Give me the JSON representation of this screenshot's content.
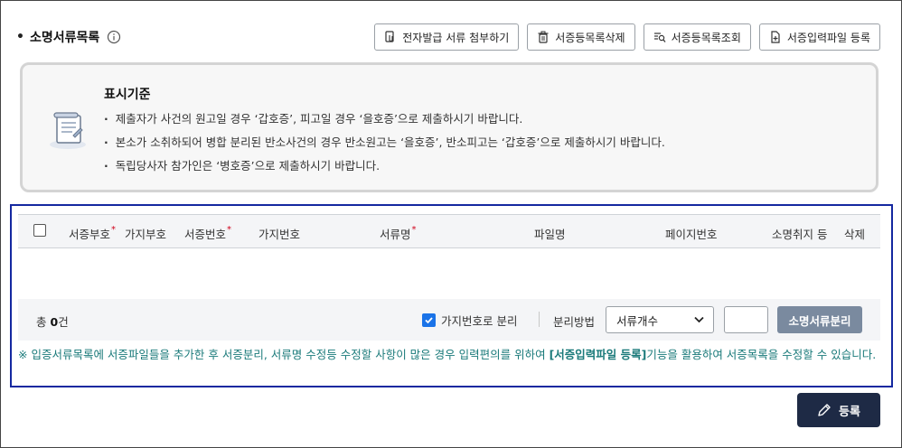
{
  "section": {
    "title": "소명서류목록",
    "bullet": "•"
  },
  "toolbar": {
    "buttons": [
      {
        "label": "전자발급 서류 첨부하기",
        "icon": "document-attach-icon"
      },
      {
        "label": "서증등목록삭제",
        "icon": "trash-icon"
      },
      {
        "label": "서증등목록조회",
        "icon": "list-search-icon"
      },
      {
        "label": "서증입력파일 등록",
        "icon": "file-add-icon"
      }
    ]
  },
  "notice": {
    "title": "표시기준",
    "icon": "scroll-document-icon",
    "items": [
      "제출자가 사건의 원고일 경우 ‘갑호증’, 피고일 경우 ‘을호증’으로 제출하시기 바랍니다.",
      "본소가 소취하되어 병합 분리된 반소사건의 경우 반소원고는 ‘을호증’, 반소피고는 ‘갑호증’으로 제출하시기 바랍니다.",
      "독립당사자 참가인은 ‘병호증’으로 제출하시기 바랍니다."
    ]
  },
  "table": {
    "columns": {
      "c1": "서증부호",
      "c2": "가지부호",
      "c3": "서증번호",
      "c4": "가지번호",
      "c5": "서류명",
      "c6": "파일명",
      "c7": "페이지번호",
      "c8": "소명취지 등",
      "c9": "삭제"
    },
    "required_mark": "*"
  },
  "summary": {
    "total_prefix": "총",
    "total_count": "0",
    "total_suffix": "건",
    "split_checkbox_label": "가지번호로 분리",
    "split_checked": true,
    "method_label": "분리방법",
    "method_selected": "서류개수",
    "count_value": "",
    "split_button": "소명서류분리"
  },
  "note": {
    "prefix": "※ 입증서류목록에 서증파일들을 추가한 후 서증분리, 서류명 수정등 수정할 사항이 많은 경우 입력편의를 위하여 ",
    "highlight": "[서증입력파일 등록]",
    "suffix": "기능을 활용하여 서증목록을 수정할 수 있습니다."
  },
  "register_button": "등록",
  "colors": {
    "highlight_border": "#1428a0",
    "note_text": "#1a7a7a",
    "register_bg": "#1e2a45",
    "split_button_bg": "#7a8a9f",
    "checkbox_blue": "#1a73e8"
  }
}
